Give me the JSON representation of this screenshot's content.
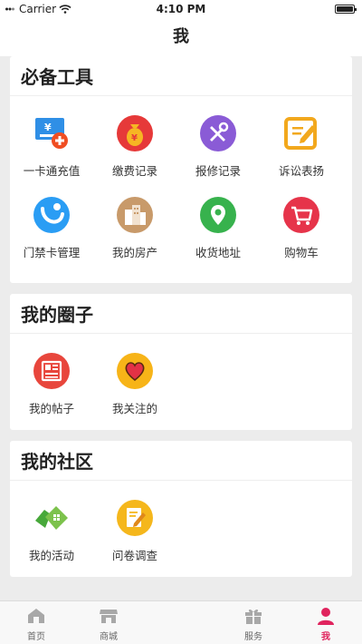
{
  "status_bar": {
    "carrier": "Carrier",
    "time": "4:10 PM"
  },
  "nav": {
    "title": "我"
  },
  "tools": {
    "title": "必备工具",
    "items": [
      {
        "label": "一卡通充值",
        "icon": "card-recharge-icon"
      },
      {
        "label": "缴费记录",
        "icon": "money-bag-icon"
      },
      {
        "label": "报修记录",
        "icon": "tools-icon"
      },
      {
        "label": "诉讼表扬",
        "icon": "edit-note-icon"
      },
      {
        "label": "门禁卡管理",
        "icon": "access-card-icon"
      },
      {
        "label": "我的房产",
        "icon": "buildings-icon"
      },
      {
        "label": "收货地址",
        "icon": "location-pin-icon"
      },
      {
        "label": "购物车",
        "icon": "shopping-cart-icon"
      }
    ]
  },
  "circle": {
    "title": "我的圈子",
    "items": [
      {
        "label": "我的帖子",
        "icon": "newspaper-icon"
      },
      {
        "label": "我关注的",
        "icon": "heart-icon"
      }
    ]
  },
  "community": {
    "title": "我的社区",
    "items": [
      {
        "label": "我的活动",
        "icon": "home-activity-icon"
      },
      {
        "label": "问卷调查",
        "icon": "survey-icon"
      }
    ]
  },
  "tab_bar": {
    "items": [
      {
        "label": "首页",
        "icon": "home-tab-icon"
      },
      {
        "label": "商城",
        "icon": "store-tab-icon"
      },
      {
        "label": "服务",
        "icon": "gift-tab-icon"
      },
      {
        "label": "我",
        "icon": "person-tab-icon",
        "active": true
      }
    ],
    "active_color": "#e0245e"
  }
}
